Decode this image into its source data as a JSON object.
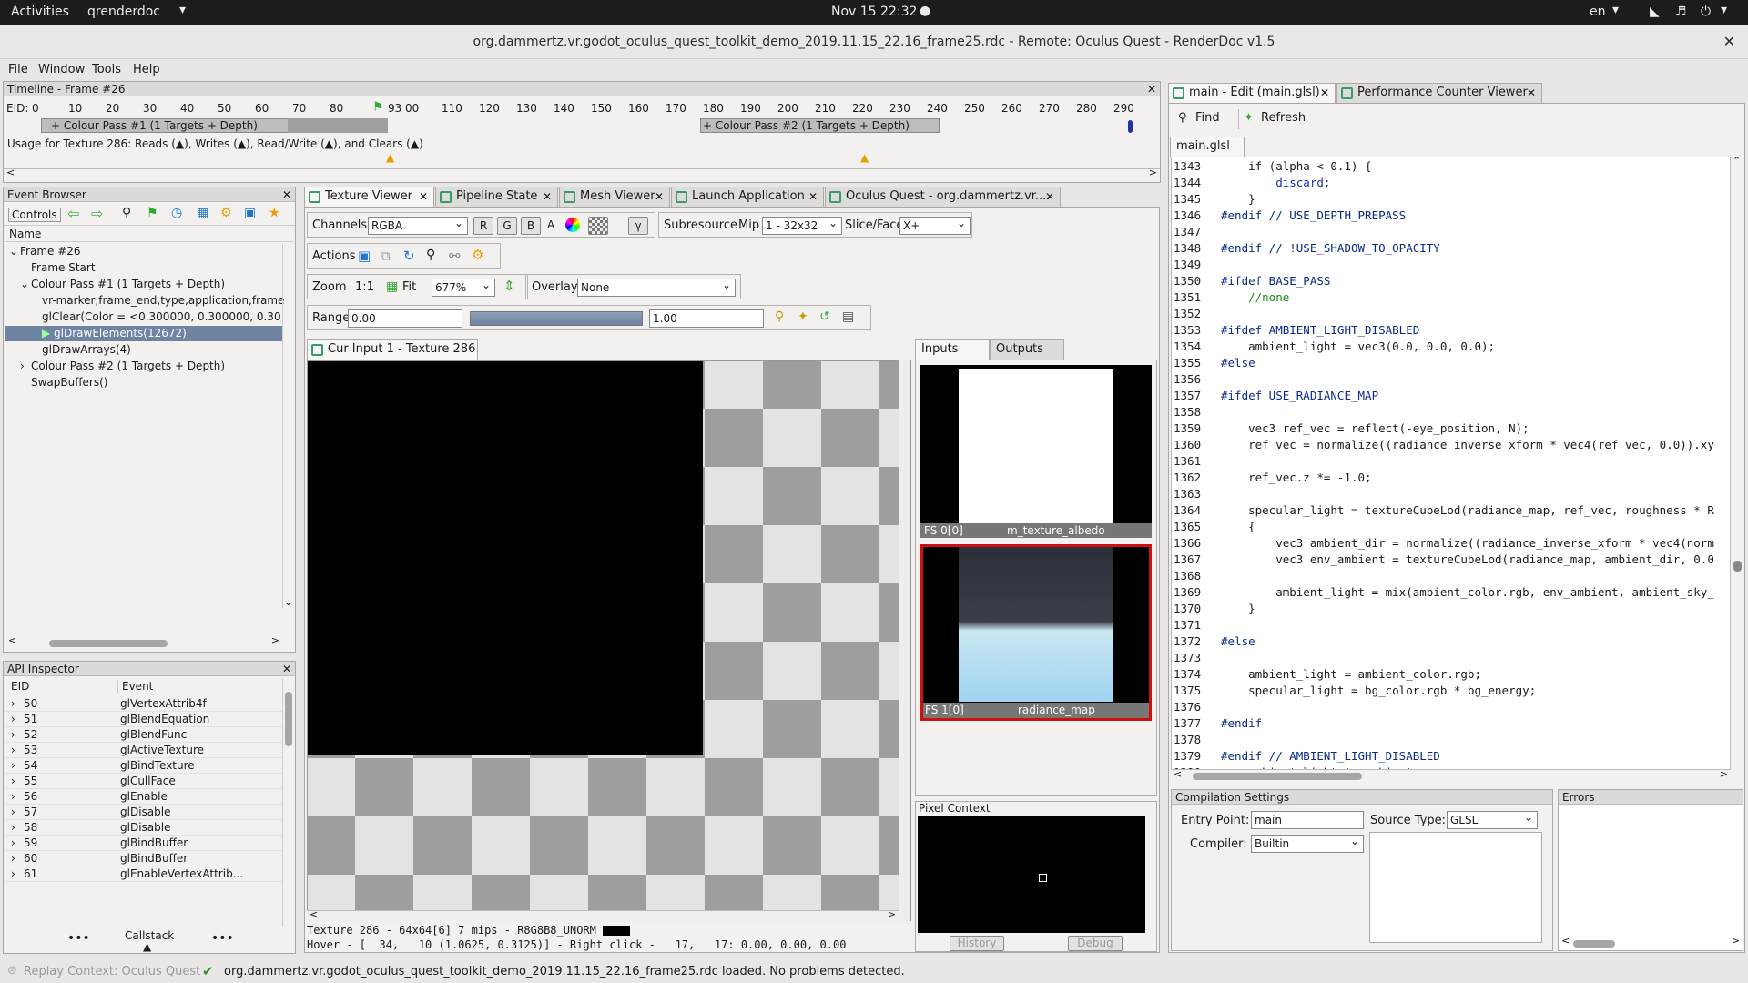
{
  "topbar": {
    "activities": "Activities",
    "app": "qrenderdoc",
    "clock": "Nov 15  22:32",
    "lang": "en"
  },
  "window": {
    "title": "org.dammertz.vr.godot_oculus_quest_toolkit_demo_2019.11.15_22.16_frame25.rdc - Remote: Oculus Quest - RenderDoc v1.5"
  },
  "menu": {
    "file": "File",
    "window": "Window",
    "tools": "Tools",
    "help": "Help"
  },
  "timeline": {
    "title": "Timeline - Frame #26",
    "eid_label": "EID:",
    "ticks": [
      "0",
      "10",
      "20",
      "30",
      "40",
      "50",
      "60",
      "70",
      "80",
      "93",
      "00",
      "110",
      "120",
      "130",
      "140",
      "150",
      "160",
      "170",
      "180",
      "190",
      "200",
      "210",
      "220",
      "230",
      "240",
      "250",
      "260",
      "270",
      "280",
      "290"
    ],
    "pass1": "+ Colour Pass #1 (1 Targets + Depth)",
    "pass2": "+ Colour Pass #2 (1 Targets + Depth)",
    "usage": "Usage for Texture 286: Reads (▲), Writes (▲), Read/Write (▲), and Clears (▲)"
  },
  "event_browser": {
    "title": "Event Browser",
    "controls": "Controls",
    "col_name": "Name",
    "rows": [
      {
        "label": "Frame #26",
        "indent": 0,
        "exp": "v"
      },
      {
        "label": "Frame Start",
        "indent": 1,
        "exp": ""
      },
      {
        "label": "Colour Pass #1 (1 Targets + Depth)",
        "indent": 1,
        "exp": "v"
      },
      {
        "label": "vr-marker,frame_end,type,application,frame",
        "indent": 2,
        "exp": ""
      },
      {
        "label": "glClear(Color = <0.300000, 0.300000, 0.30",
        "indent": 2,
        "exp": ""
      },
      {
        "label": "glDrawElements(12672)",
        "indent": 2,
        "exp": "",
        "selected": true
      },
      {
        "label": "glDrawArrays(4)",
        "indent": 2,
        "exp": ""
      },
      {
        "label": "Colour Pass #2 (1 Targets + Depth)",
        "indent": 1,
        "exp": ">"
      },
      {
        "label": "SwapBuffers()",
        "indent": 1,
        "exp": ""
      }
    ]
  },
  "api_inspector": {
    "title": "API Inspector",
    "col_eid": "EID",
    "col_event": "Event",
    "rows": [
      {
        "eid": "50",
        "event": "glVertexAttrib4f"
      },
      {
        "eid": "51",
        "event": "glBlendEquation"
      },
      {
        "eid": "52",
        "event": "glBlendFunc"
      },
      {
        "eid": "53",
        "event": "glActiveTexture"
      },
      {
        "eid": "54",
        "event": "glBindTexture"
      },
      {
        "eid": "55",
        "event": "glCullFace"
      },
      {
        "eid": "56",
        "event": "glEnable"
      },
      {
        "eid": "57",
        "event": "glDisable"
      },
      {
        "eid": "58",
        "event": "glDisable"
      },
      {
        "eid": "59",
        "event": "glBindBuffer"
      },
      {
        "eid": "60",
        "event": "glBindBuffer"
      },
      {
        "eid": "61",
        "event": "glEnableVertexAttrib..."
      }
    ],
    "callstack": "Callstack"
  },
  "tabs": {
    "texture_viewer": "Texture Viewer",
    "pipeline_state": "Pipeline State",
    "mesh_viewer": "Mesh Viewer",
    "launch_app": "Launch Application",
    "oculus": "Oculus Quest - org.dammertz.vr...."
  },
  "texviewer": {
    "channels_label": "Channels",
    "channels_value": "RGBA",
    "r": "R",
    "g": "G",
    "b": "B",
    "a": "A",
    "gamma": "γ",
    "subresource": "Subresource",
    "mip_label": "Mip",
    "mip_value": "1 - 32x32",
    "slice_label": "Slice/Face",
    "slice_value": "X+",
    "actions": "Actions",
    "zoom_label": "Zoom",
    "zoom_11": "1:1",
    "fit": "Fit",
    "zoom_value": "677%",
    "overlay_label": "Overlay",
    "overlay_value": "None",
    "range_label": "Range",
    "range_min": "0.00",
    "range_max": "1.00",
    "cur_input": "Cur Input 1 - Texture 286",
    "status1": "Texture 286 - 64x64[6] 7 mips - R8G8B8_UNORM",
    "status2": "Hover - [  34,   10 (1.0625, 0.3125)] - Right click -   17,   17: 0.00, 0.00, 0.00"
  },
  "thumbs": {
    "inputs": "Inputs",
    "outputs": "Outputs",
    "t1_slot": "FS 0[0]",
    "t1_name": "m_texture_albedo",
    "t2_slot": "FS 1[0]",
    "t2_name": "radiance_map",
    "pixel_context": "Pixel Context",
    "history": "History",
    "debug": "Debug"
  },
  "editor": {
    "tab1": "main - Edit (main.glsl)",
    "tab2": "Performance Counter Viewer",
    "find": "Find",
    "refresh": "Refresh",
    "file_tab": "main.glsl",
    "lines": [
      {
        "n": "1343",
        "t": "    if (alpha < 0.1) {"
      },
      {
        "n": "1344",
        "t": "        discard;"
      },
      {
        "n": "1345",
        "t": "    }"
      },
      {
        "n": "1346",
        "t": "#endif // USE_DEPTH_PREPASS"
      },
      {
        "n": "1347",
        "t": ""
      },
      {
        "n": "1348",
        "t": "#endif // !USE_SHADOW_TO_OPACITY"
      },
      {
        "n": "1349",
        "t": ""
      },
      {
        "n": "1350",
        "t": "#ifdef BASE_PASS"
      },
      {
        "n": "1351",
        "t": "    //none"
      },
      {
        "n": "1352",
        "t": ""
      },
      {
        "n": "1353",
        "t": "#ifdef AMBIENT_LIGHT_DISABLED"
      },
      {
        "n": "1354",
        "t": "    ambient_light = vec3(0.0, 0.0, 0.0);"
      },
      {
        "n": "1355",
        "t": "#else"
      },
      {
        "n": "1356",
        "t": ""
      },
      {
        "n": "1357",
        "t": "#ifdef USE_RADIANCE_MAP"
      },
      {
        "n": "1358",
        "t": ""
      },
      {
        "n": "1359",
        "t": "    vec3 ref_vec = reflect(-eye_position, N);"
      },
      {
        "n": "1360",
        "t": "    ref_vec = normalize((radiance_inverse_xform * vec4(ref_vec, 0.0)).xy"
      },
      {
        "n": "1361",
        "t": ""
      },
      {
        "n": "1362",
        "t": "    ref_vec.z *= -1.0;"
      },
      {
        "n": "1363",
        "t": ""
      },
      {
        "n": "1364",
        "t": "    specular_light = textureCubeLod(radiance_map, ref_vec, roughness * R"
      },
      {
        "n": "1365",
        "t": "    {"
      },
      {
        "n": "1366",
        "t": "        vec3 ambient_dir = normalize((radiance_inverse_xform * vec4(norm"
      },
      {
        "n": "1367",
        "t": "        vec3 env_ambient = textureCubeLod(radiance_map, ambient_dir, 0.0"
      },
      {
        "n": "1368",
        "t": ""
      },
      {
        "n": "1369",
        "t": "        ambient_light = mix(ambient_color.rgb, env_ambient, ambient_sky_"
      },
      {
        "n": "1370",
        "t": "    }"
      },
      {
        "n": "1371",
        "t": ""
      },
      {
        "n": "1372",
        "t": "#else"
      },
      {
        "n": "1373",
        "t": ""
      },
      {
        "n": "1374",
        "t": "    ambient_light = ambient_color.rgb;"
      },
      {
        "n": "1375",
        "t": "    specular_light = bg_color.rgb * bg_energy;"
      },
      {
        "n": "1376",
        "t": ""
      },
      {
        "n": "1377",
        "t": "#endif"
      },
      {
        "n": "1378",
        "t": ""
      },
      {
        "n": "1379",
        "t": "#endif // AMBIENT_LIGHT_DISABLED"
      },
      {
        "n": "1380",
        "t": "    ambient_light *= ambient_energy;"
      }
    ]
  },
  "compile": {
    "title": "Compilation Settings",
    "entry_label": "Entry Point:",
    "entry_value": "main",
    "source_label": "Source Type:",
    "source_value": "GLSL",
    "compiler_label": "Compiler:",
    "compiler_value": "Builtin",
    "errors": "Errors"
  },
  "statusbar": {
    "context": "Replay Context: Oculus Quest",
    "message": "org.dammertz.vr.godot_oculus_quest_toolkit_demo_2019.11.15_22.16_frame25.rdc loaded. No problems detected."
  }
}
